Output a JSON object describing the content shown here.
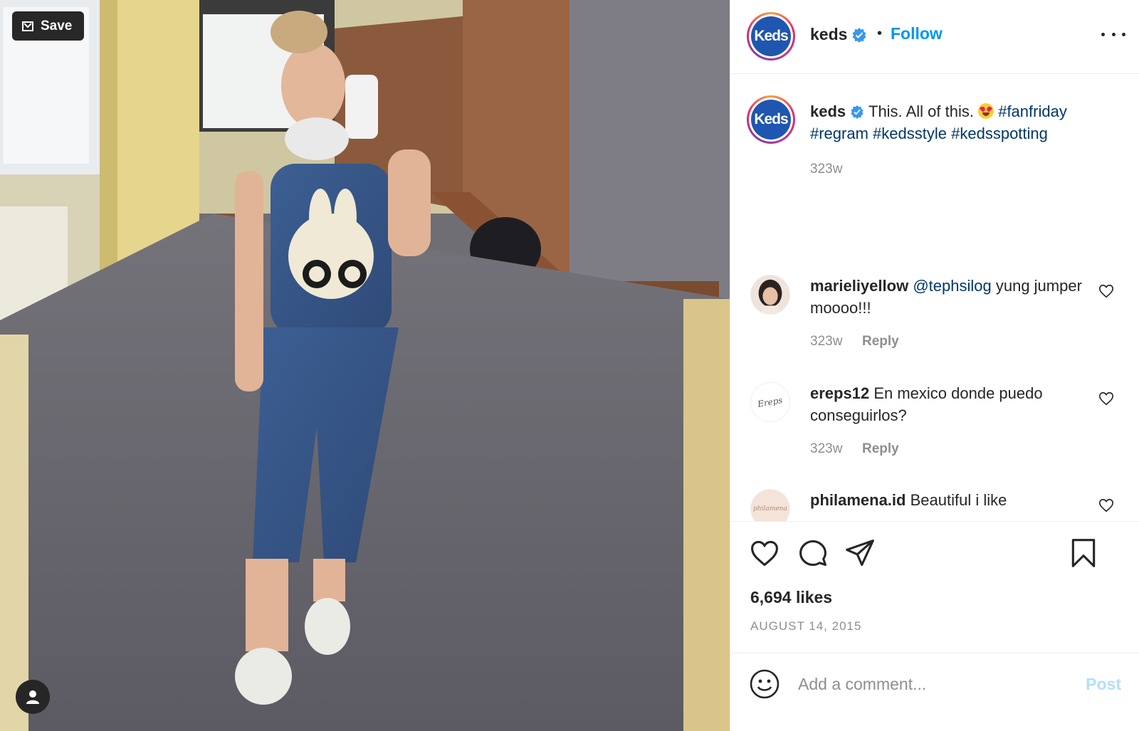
{
  "photo": {
    "save_label": "Save"
  },
  "header": {
    "username": "keds",
    "separator": "•",
    "follow_label": "Follow",
    "logo_text": "Keds"
  },
  "caption": {
    "username": "keds",
    "text": "This. All of this.",
    "hashtags": [
      "#fanfriday",
      "#regram",
      "#kedsstyle",
      "#kedsspotting"
    ],
    "time": "323w"
  },
  "comments": [
    {
      "username": "marieliyellow",
      "mention": "@tephsilog",
      "text": "yung jumper moooo!!!",
      "time": "323w",
      "reply_label": "Reply"
    },
    {
      "username": "ereps12",
      "text": "En mexico donde puedo conseguirlos?",
      "time": "323w",
      "reply_label": "Reply",
      "avatar_text": "Ereps"
    },
    {
      "username": "philamena.id",
      "text": "Beautiful i like",
      "avatar_text": "philamena"
    }
  ],
  "actions": {
    "likes": "6,694 likes",
    "date": "AUGUST 14, 2015"
  },
  "add_comment": {
    "placeholder": "Add a comment...",
    "post_label": "Post"
  },
  "colors": {
    "accent": "#0095f6",
    "hashtag": "#00376b",
    "keds_blue": "#1f56b0",
    "muted": "#8e8e8e"
  },
  "icons": [
    "save-icon",
    "person-icon",
    "verified-icon",
    "more-icon",
    "heart-icon",
    "comment-icon",
    "share-icon",
    "bookmark-icon",
    "smile-icon"
  ]
}
